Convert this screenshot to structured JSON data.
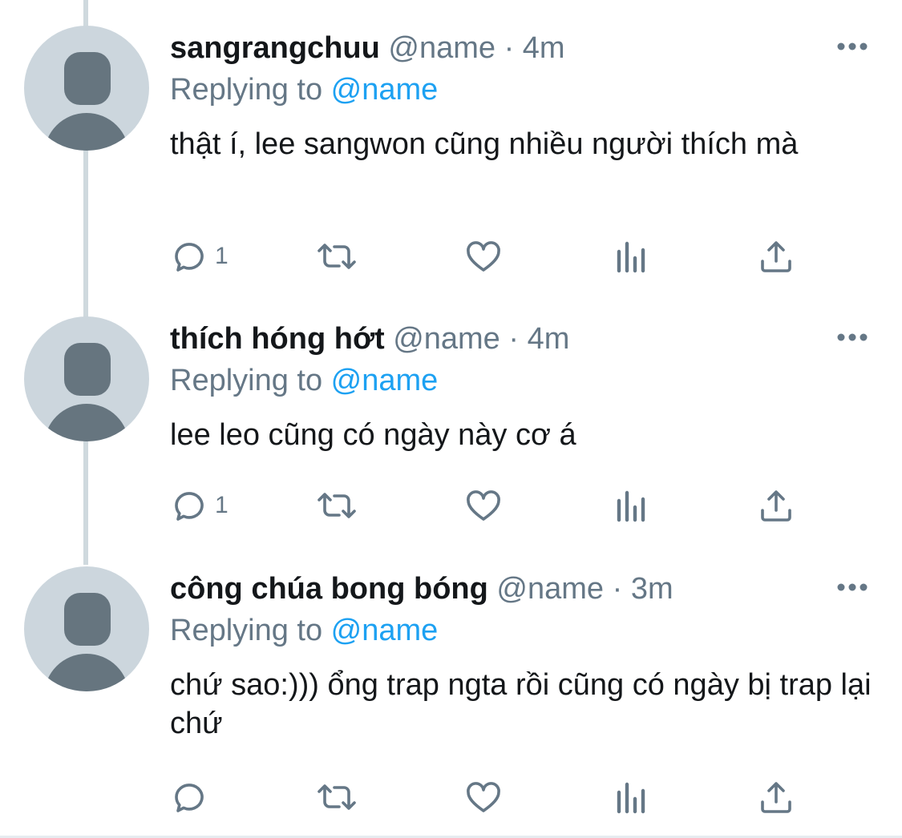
{
  "tweets": [
    {
      "name": "sangrangchuu",
      "handle": "@name",
      "sep": "·",
      "time": "4m",
      "replying_prefix": "Replying to ",
      "replying_to": "@name",
      "text": "thật í, lee sangwon cũng nhiều người thích mà",
      "reply_count": "1"
    },
    {
      "name": "thích hóng hớt",
      "handle": "@name",
      "sep": "·",
      "time": "4m",
      "replying_prefix": "Replying to ",
      "replying_to": "@name",
      "text": "lee leo cũng có ngày này cơ á",
      "reply_count": "1"
    },
    {
      "name": "công chúa bong bóng",
      "handle": "@name",
      "sep": "·",
      "time": "3m",
      "replying_prefix": "Replying to ",
      "replying_to": "@name",
      "text": "chứ sao:))) ổng trap ngta rồi cũng có ngày bị trap lại chứ",
      "reply_count": ""
    }
  ],
  "icons": {
    "more": "more-icon",
    "reply": "reply-icon",
    "retweet": "retweet-icon",
    "like": "heart-icon",
    "analytics": "analytics-icon",
    "share": "share-icon"
  },
  "colors": {
    "text": "#14171a",
    "secondary": "#657786",
    "mention": "#1da1f2",
    "avatar_bg": "#ccd6dd",
    "avatar_fg": "#66757f",
    "thread_line": "#cfd9de"
  }
}
